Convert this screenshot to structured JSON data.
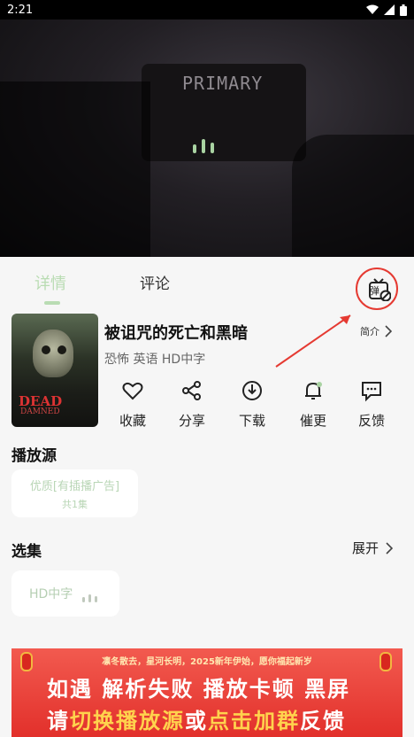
{
  "status_bar": {
    "time": "2:21"
  },
  "video": {
    "board_text": "PRIMARY"
  },
  "tabs": [
    {
      "label": "详情"
    },
    {
      "label": "评论"
    }
  ],
  "danmu_button": {
    "label": "弹"
  },
  "movie": {
    "title": "被诅咒的死亡和黑暗",
    "meta": "恐怖 英语 HD中字",
    "intro_label": "简介",
    "poster_title": "DEAD",
    "poster_subtitle": "DAMNED"
  },
  "actions": [
    {
      "label": "收藏",
      "icon": "heart-icon"
    },
    {
      "label": "分享",
      "icon": "share-icon"
    },
    {
      "label": "下载",
      "icon": "download-icon"
    },
    {
      "label": "催更",
      "icon": "bell-icon"
    },
    {
      "label": "反馈",
      "icon": "feedback-icon"
    }
  ],
  "sources": {
    "title": "播放源",
    "items": [
      {
        "name": "优质[有插播广告]",
        "count": "共1集"
      }
    ]
  },
  "episodes": {
    "title": "选集",
    "expand_label": "展开",
    "items": [
      {
        "label": "HD中字"
      }
    ]
  },
  "banner": {
    "top_text": "凛冬散去，星河长明，2025新年伊始，愿你福起新岁",
    "line1": "如遇 解析失败 播放卡顿 黑屏",
    "line2_a": "请",
    "line2_b": "切换播放源",
    "line2_c": "或",
    "line2_d": "点击加群",
    "line2_e": "反馈"
  },
  "colors": {
    "accent": "#b9dcb3",
    "highlight": "#e53a32"
  }
}
